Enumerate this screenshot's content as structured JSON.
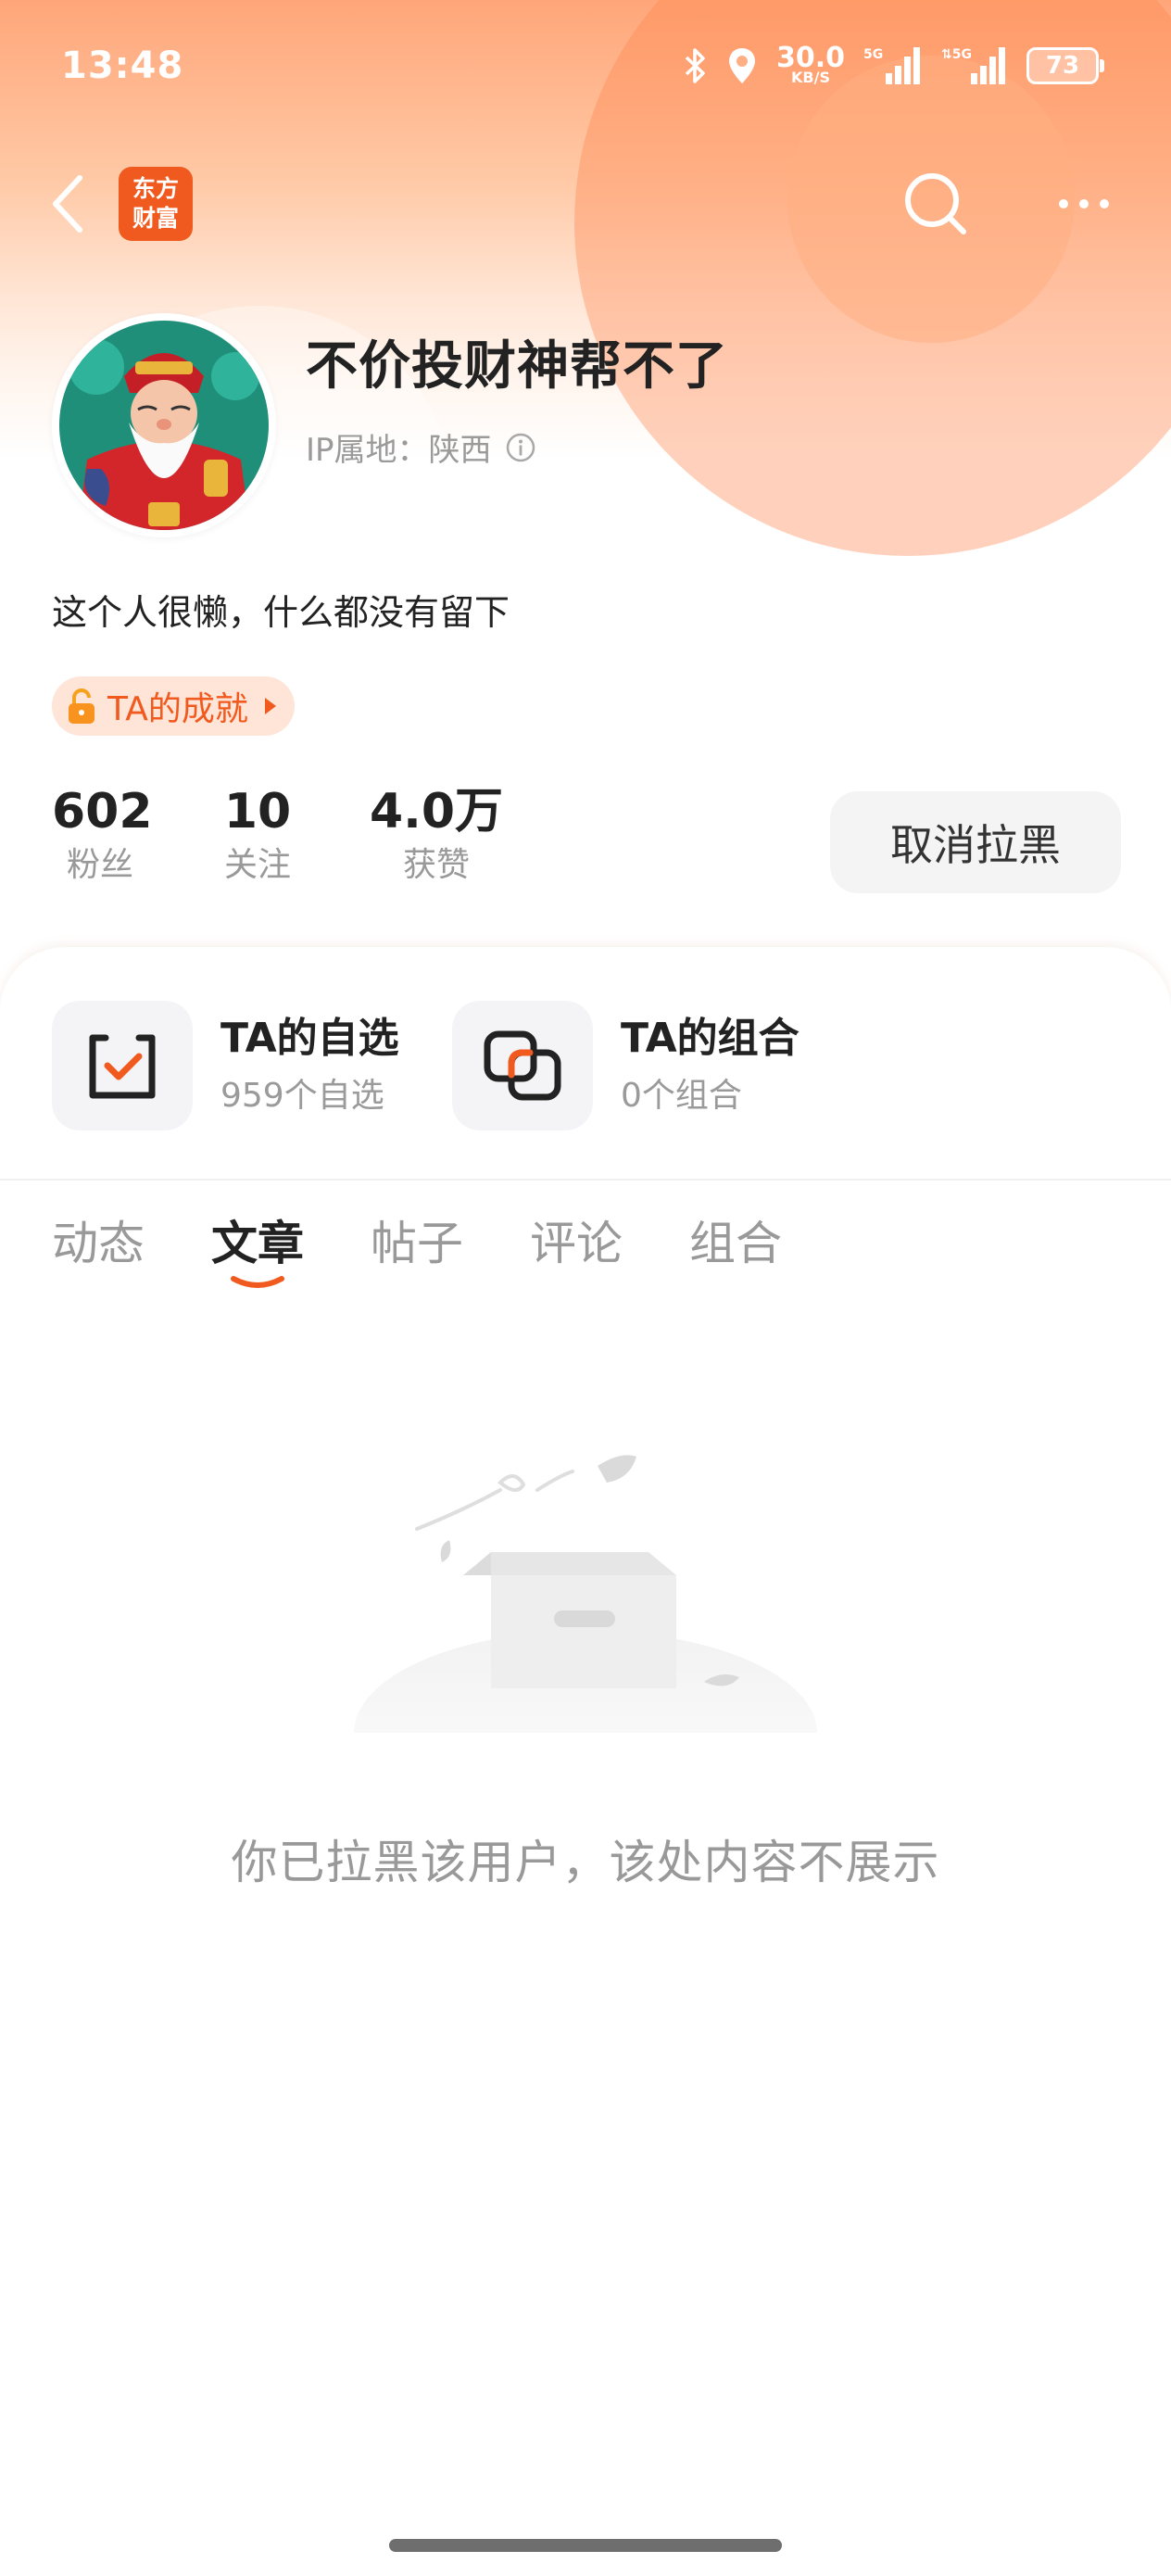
{
  "status_bar": {
    "time": "13:48",
    "net_speed": "30.0",
    "net_unit": "KB/S",
    "battery": "73"
  },
  "nav": {
    "logo_line1": "东方",
    "logo_line2": "财富"
  },
  "profile": {
    "name": "不价投财神帮不了",
    "ip_location": "IP属地：陕西",
    "bio": "这个人很懒，什么都没有留下",
    "achievement_label": "TA的成就"
  },
  "stats": [
    {
      "value": "602",
      "label": "粉丝"
    },
    {
      "value": "10",
      "label": "关注"
    },
    {
      "value": "4.0万",
      "label": "获赞"
    }
  ],
  "unblock_label": "取消拉黑",
  "portfolio": {
    "watchlist_title": "TA的自选",
    "watchlist_sub": "959个自选",
    "combo_title": "TA的组合",
    "combo_sub": "0个组合"
  },
  "tabs": [
    "动态",
    "文章",
    "帖子",
    "评论",
    "组合"
  ],
  "active_tab": "文章",
  "empty_message": "你已拉黑该用户，该处内容不展示",
  "colors": {
    "accent": "#f15a1e",
    "hero_top": "#ffa679",
    "muted": "#999999"
  }
}
